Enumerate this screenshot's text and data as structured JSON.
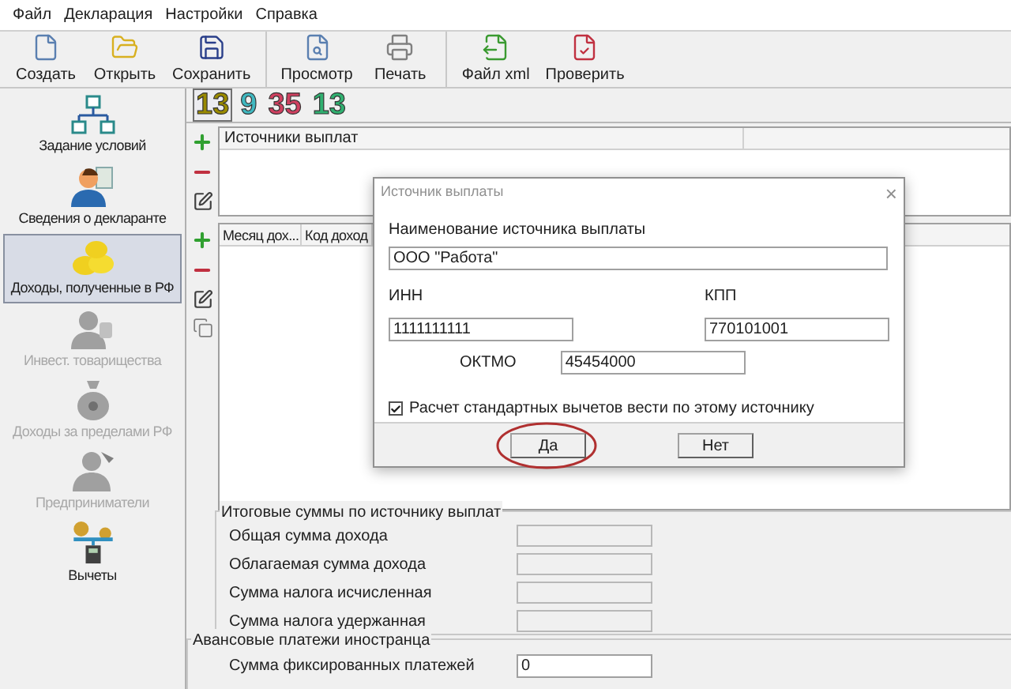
{
  "menu": [
    "Файл",
    "Декларация",
    "Настройки",
    "Справка"
  ],
  "toolbar": [
    [
      {
        "label": "Создать",
        "kind": "new"
      },
      {
        "label": "Открыть",
        "kind": "open"
      },
      {
        "label": "Сохранить",
        "kind": "save"
      }
    ],
    [
      {
        "label": "Просмотр",
        "kind": "preview"
      },
      {
        "label": "Печать",
        "kind": "print"
      }
    ],
    [
      {
        "label": "Файл xml",
        "kind": "export"
      },
      {
        "label": "Проверить",
        "kind": "check"
      }
    ]
  ],
  "year_tabs": [
    {
      "label": "13",
      "color": "#9a8a00",
      "selected": true
    },
    {
      "label": "9",
      "color": "#40b8c0",
      "selected": false
    },
    {
      "label": "35",
      "color": "#d04060",
      "selected": false
    },
    {
      "label": "13",
      "color": "#30b070",
      "selected": false
    }
  ],
  "sidebar": [
    {
      "label": "Задание условий",
      "kind": "conditions",
      "selected": false,
      "disabled": false
    },
    {
      "label": "Сведения о декларанте",
      "kind": "person",
      "selected": false,
      "disabled": false
    },
    {
      "label": "Доходы, полученные в РФ",
      "kind": "coins",
      "selected": true,
      "disabled": false
    },
    {
      "label": "Инвест. товарищества",
      "kind": "investor",
      "selected": false,
      "disabled": true
    },
    {
      "label": "Доходы за пределами РФ",
      "kind": "moneybag",
      "selected": false,
      "disabled": true
    },
    {
      "label": "Предприниматели",
      "kind": "business",
      "selected": false,
      "disabled": true
    },
    {
      "label": "Вычеты",
      "kind": "deductions",
      "selected": false,
      "disabled": false
    }
  ],
  "sources_table": {
    "columns": [
      "Источники выплат"
    ]
  },
  "income_table": {
    "columns": [
      "Месяц дох...",
      "Код доход"
    ]
  },
  "totals": {
    "title": "Итоговые суммы по источнику выплат",
    "rows": [
      {
        "label": "Общая сумма дохода",
        "disabled": true
      },
      {
        "label": "Облагаемая сумма дохода",
        "disabled": true
      },
      {
        "label": "Сумма налога исчисленная",
        "disabled": true
      },
      {
        "label": "Сумма налога удержанная",
        "disabled": true
      }
    ]
  },
  "advance": {
    "title": "Авансовые платежи иностранца",
    "rows": [
      {
        "label": "Сумма фиксированных платежей",
        "value": "0"
      }
    ]
  },
  "dialog": {
    "title": "Источник выплаты",
    "close": "×",
    "name_label": "Наименование источника выплаты",
    "name_value": "ООО \"Работа\"",
    "inn_label": "ИНН",
    "inn_value": "1111111111",
    "kpp_label": "КПП",
    "kpp_value": "770101001",
    "oktmo_label": "ОКТМО",
    "oktmo_value": "45454000",
    "checkbox": {
      "label": "Расчет стандартных вычетов вести по этому источнику",
      "checked": true
    },
    "buttons": [
      {
        "label": "Да",
        "circled": true
      },
      {
        "label": "Нет",
        "circled": false
      }
    ]
  }
}
